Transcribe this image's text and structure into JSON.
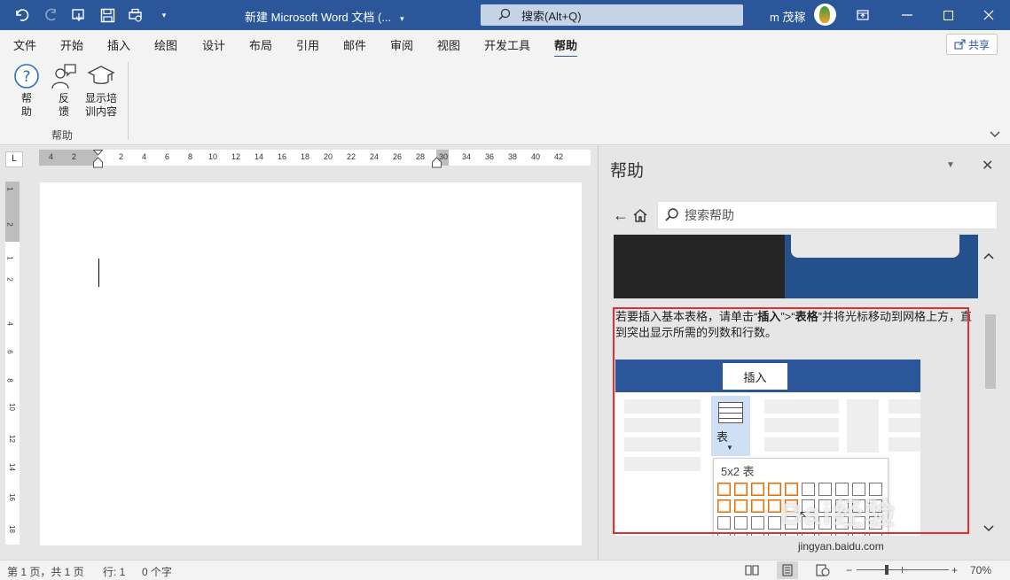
{
  "titlebar": {
    "doc_title": "新建 Microsoft Word 文档 (...",
    "search_label": "搜索(Alt+Q)",
    "user_name": "m 茂稼",
    "bg_color": "#2b579a"
  },
  "tabs": [
    {
      "label": "文件",
      "active": false
    },
    {
      "label": "开始",
      "active": false
    },
    {
      "label": "插入",
      "active": false
    },
    {
      "label": "绘图",
      "active": false
    },
    {
      "label": "设计",
      "active": false
    },
    {
      "label": "布局",
      "active": false
    },
    {
      "label": "引用",
      "active": false
    },
    {
      "label": "邮件",
      "active": false
    },
    {
      "label": "审阅",
      "active": false
    },
    {
      "label": "视图",
      "active": false
    },
    {
      "label": "开发工具",
      "active": false
    },
    {
      "label": "帮助",
      "active": true
    }
  ],
  "share_label": "共享",
  "ribbon": {
    "buttons": [
      {
        "line1": "帮",
        "line2": "助",
        "icon": "help-icon"
      },
      {
        "line1": "反",
        "line2": "馈",
        "icon": "feedback-icon"
      },
      {
        "line1": "显示培",
        "line2": "训内容",
        "icon": "training-icon"
      }
    ],
    "group_label": "帮助"
  },
  "ruler": {
    "corner": "L",
    "h_labels": [
      "4",
      "2",
      "2",
      "4",
      "6",
      "8",
      "10",
      "12",
      "14",
      "16",
      "18",
      "20",
      "22",
      "24",
      "26",
      "28",
      "30",
      "34",
      "36",
      "38",
      "40",
      "42"
    ],
    "v_labels": [
      "1",
      "2",
      "1",
      "2",
      "4",
      "6",
      "8",
      "10",
      "12",
      "14",
      "16",
      "18"
    ]
  },
  "help_pane": {
    "title": "帮助",
    "search_placeholder": "搜索帮助",
    "text_part1": "若要插入基本表格，请单击“",
    "text_bold1": "插入",
    "text_part2": "”>“",
    "text_bold2": "表格",
    "text_part3": "”并将光标移动到网格上方，直到突出显示所需的列数和行数。",
    "illustration": {
      "tab_label": "插入",
      "table_button_label": "表",
      "grid_label": "5x2 表",
      "grid_cols": 10,
      "grid_rows": 4,
      "highlight_cols": 5,
      "highlight_rows": 2
    },
    "watermark": "Bai经验",
    "watermark_url": "jingyan.baidu.com"
  },
  "statusbar": {
    "page": "第 1 页，共 1 页",
    "line": "行: 1",
    "words": "0 个字",
    "zoom": "70%"
  }
}
